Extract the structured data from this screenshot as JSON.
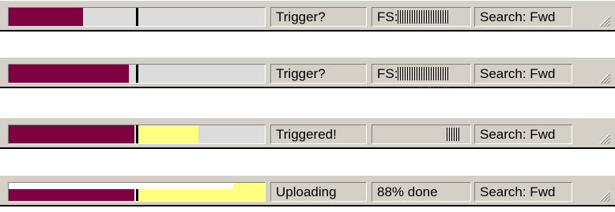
{
  "status_bars": [
    {
      "trigger_status": "Trigger?",
      "fs_prefix": "FS:",
      "fs_ticks": 22,
      "search": "Search: Fwd",
      "buffer_fill_fraction": 0.29,
      "trigger_marker_fraction": 0.5,
      "yellow_end_fraction": 0.5,
      "colors": {
        "fill": "#7f0040",
        "yellow": "#ffff80",
        "track": "#dcdcdc"
      }
    },
    {
      "trigger_status": "Trigger?",
      "fs_prefix": "FS:",
      "fs_ticks": 22,
      "search": "Search: Fwd",
      "buffer_fill_fraction": 0.47,
      "trigger_marker_fraction": 0.5,
      "yellow_end_fraction": 0.5,
      "colors": {
        "fill": "#7f0040",
        "yellow": "#ffff80",
        "track": "#dcdcdc"
      }
    },
    {
      "trigger_status": "Triggered!",
      "fs_prefix": "",
      "fs_ticks": 6,
      "search": "Search: Fwd",
      "buffer_fill_fraction": 0.49,
      "trigger_marker_fraction": 0.5,
      "yellow_end_fraction": 0.74,
      "colors": {
        "fill": "#7f0040",
        "yellow": "#ffff80",
        "track": "#dcdcdc"
      }
    },
    {
      "trigger_status": "Uploading",
      "fs_text": "88% done",
      "search": "Search: Fwd",
      "buffer_fill_fraction": 0.49,
      "trigger_marker_fraction": 0.5,
      "yellow_end_fraction": 1.0,
      "upload_progress_fraction": 0.88,
      "colors": {
        "fill": "#7f0040",
        "yellow": "#ffff80",
        "track": "#ffffff"
      }
    }
  ]
}
